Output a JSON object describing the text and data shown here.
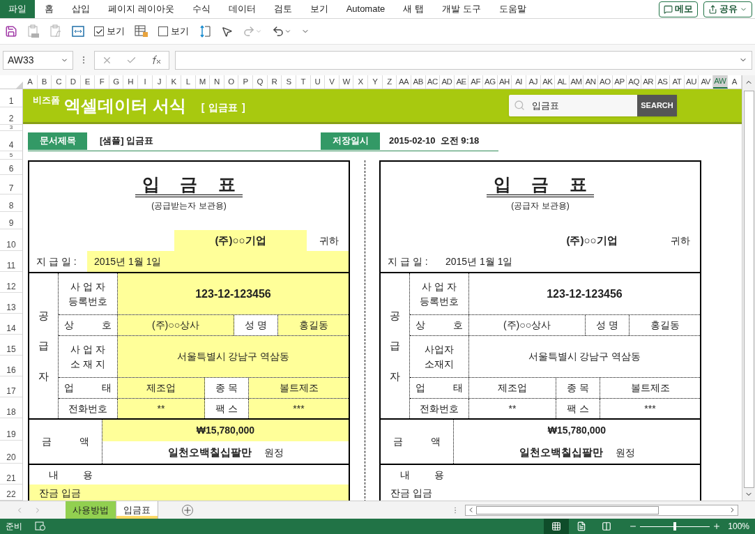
{
  "ribbon": {
    "file_button": "파일",
    "tabs": [
      {
        "label": "홈",
        "selected": false
      },
      {
        "label": "삽입",
        "selected": false
      },
      {
        "label": "페이지 레이아웃",
        "selected": false
      },
      {
        "label": "수식",
        "selected": false
      },
      {
        "label": "데이터",
        "selected": false
      },
      {
        "label": "검토",
        "selected": false
      },
      {
        "label": "보기",
        "selected": false
      },
      {
        "label": "Automate",
        "selected": false
      },
      {
        "label": "새 탭",
        "selected": false
      },
      {
        "label": "개발 도구",
        "selected": false
      },
      {
        "label": "도움말",
        "selected": false
      }
    ],
    "memo_button": "메모",
    "share_button": "공유"
  },
  "quick_access": [
    {
      "kind": "save",
      "disabled": false
    },
    {
      "kind": "paste-values",
      "disabled": true
    },
    {
      "kind": "paste-formula",
      "disabled": true
    },
    {
      "kind": "fit"
    },
    {
      "kind": "checkbox",
      "label": "보기",
      "checked": true
    },
    {
      "kind": "table-lock"
    },
    {
      "kind": "checkbox",
      "label": "보기",
      "checked": false
    },
    {
      "kind": "row-height"
    },
    {
      "kind": "pointer",
      "disabled": false
    },
    {
      "kind": "redo",
      "disabled": true
    },
    {
      "kind": "undo",
      "disabled": false
    },
    {
      "kind": "customize",
      "disabled": false
    }
  ],
  "formula_bar": {
    "name_box": "AW33"
  },
  "columns": [
    {
      "label": "A",
      "selected": false
    },
    {
      "label": "B",
      "selected": false
    },
    {
      "label": "C",
      "selected": false
    },
    {
      "label": "D",
      "selected": false
    },
    {
      "label": "E",
      "selected": false
    },
    {
      "label": "F",
      "selected": false
    },
    {
      "label": "G",
      "selected": false
    },
    {
      "label": "H",
      "selected": false
    },
    {
      "label": "I",
      "selected": false
    },
    {
      "label": "J",
      "selected": false
    },
    {
      "label": "K",
      "selected": false
    },
    {
      "label": "L",
      "selected": false
    },
    {
      "label": "M",
      "selected": false
    },
    {
      "label": "N",
      "selected": false
    },
    {
      "label": "O",
      "selected": false
    },
    {
      "label": "P",
      "selected": false
    },
    {
      "label": "Q",
      "selected": false
    },
    {
      "label": "R",
      "selected": false
    },
    {
      "label": "S",
      "selected": false
    },
    {
      "label": "T",
      "selected": false
    },
    {
      "label": "U",
      "selected": false
    },
    {
      "label": "V",
      "selected": false
    },
    {
      "label": "W",
      "selected": false
    },
    {
      "label": "X",
      "selected": false
    },
    {
      "label": "Y",
      "selected": false
    },
    {
      "label": "Z",
      "selected": false
    },
    {
      "label": "AA",
      "selected": false
    },
    {
      "label": "AB",
      "selected": false
    },
    {
      "label": "AC",
      "selected": false
    },
    {
      "label": "AD",
      "selected": false
    },
    {
      "label": "AE",
      "selected": false
    },
    {
      "label": "AF",
      "selected": false
    },
    {
      "label": "AG",
      "selected": false
    },
    {
      "label": "AH",
      "selected": false
    },
    {
      "label": "AI",
      "selected": false
    },
    {
      "label": "AJ",
      "selected": false
    },
    {
      "label": "AK",
      "selected": false
    },
    {
      "label": "AL",
      "selected": false
    },
    {
      "label": "AM",
      "selected": false
    },
    {
      "label": "AN",
      "selected": false
    },
    {
      "label": "AO",
      "selected": false
    },
    {
      "label": "AP",
      "selected": false
    },
    {
      "label": "AQ",
      "selected": false
    },
    {
      "label": "AR",
      "selected": false
    },
    {
      "label": "AS",
      "selected": false
    },
    {
      "label": "AT",
      "selected": false
    },
    {
      "label": "AU",
      "selected": false
    },
    {
      "label": "AV",
      "selected": false
    },
    {
      "label": "AW",
      "selected": true
    },
    {
      "label": "A",
      "selected": false
    }
  ],
  "rows": [
    "1",
    "2",
    "3",
    "4",
    "5",
    "6",
    "7",
    "8",
    "9",
    "10",
    "11",
    "12",
    "13",
    "14",
    "15",
    "16",
    "17",
    "18",
    "19",
    "20",
    "21",
    "22"
  ],
  "banner": {
    "brand": "비즈폼",
    "title": "엑셀데이터 서식",
    "subtitle": "[ 입금표 ]",
    "search_value": "입금표",
    "search_button": "SEARCH"
  },
  "doc_info": {
    "title_label": "문서제목",
    "title": "[샘플] 입금표",
    "saved_label": "저장일시",
    "saved": "2015-02-10  오전 9:18"
  },
  "forms": [
    {
      "input_shading": true,
      "title": "입 금 표",
      "subtitle": "(공급받는자 보관용)",
      "recipient": "(주)○○기업",
      "recipient_suffix": "귀하",
      "date_label": "지 급 일 :",
      "date": "2015년 1월 1일",
      "supplier": {
        "label": "공급자",
        "reg_label": "사 업 자\n등록번호",
        "reg_no": "123-12-123456",
        "name_label": "상 호",
        "company": "(주)○○상사",
        "rep_label": "성 명",
        "rep": "홍길동",
        "addr_label": "사 업 자\n소 재 지",
        "addr": "서울특별시 강남구 역삼동",
        "type_label": "업 태",
        "type": "제조업",
        "item_label": "종 목",
        "item": "볼트제조",
        "phone_label": "전화번호",
        "phone": "**",
        "fax_label": "팩 스",
        "fax": "***"
      },
      "amount": {
        "label": "금 액",
        "figure": "₩15,780,000",
        "words": "일천오백칠십팔만",
        "suffix": "원정"
      },
      "content_label": "내 용",
      "content": "잔금 입금"
    },
    {
      "input_shading": false,
      "title": "입 금 표",
      "subtitle": "(공급자 보관용)",
      "recipient": "(주)○○기업",
      "recipient_suffix": "귀하",
      "date_label": "지 급 일 :",
      "date": "2015년 1월 1일",
      "supplier": {
        "label": "공급자",
        "reg_label": "사 업 자\n등록번호",
        "reg_no": "123-12-123456",
        "name_label": "상 호",
        "company": "(주)○○상사",
        "rep_label": "성 명",
        "rep": "홍길동",
        "addr_label": "사업자\n소재지",
        "addr": "서울특별시 강남구 역삼동",
        "type_label": "업 태",
        "type": "제조업",
        "item_label": "종 목",
        "item": "볼트제조",
        "phone_label": "전화번호",
        "phone": "**",
        "fax_label": "팩 스",
        "fax": "***"
      },
      "amount": {
        "label": "금 액",
        "figure": "₩15,780,000",
        "words": "일천오백칠십팔만",
        "suffix": "원정"
      },
      "content_label": "내 용",
      "content": "잔금 입금"
    }
  ],
  "sheet_tabs": [
    {
      "label": "사용방법",
      "selected": false,
      "color": "#92d050"
    },
    {
      "label": "입금표",
      "selected": true,
      "color": "#ffd966"
    }
  ],
  "status_bar": {
    "status": "준비",
    "view": [
      {
        "kind": "normal",
        "selected": true
      },
      {
        "kind": "page-layout",
        "selected": false
      },
      {
        "kind": "page-break",
        "selected": false
      }
    ],
    "zoom": {
      "level": 0.5,
      "reading": "100%"
    }
  }
}
